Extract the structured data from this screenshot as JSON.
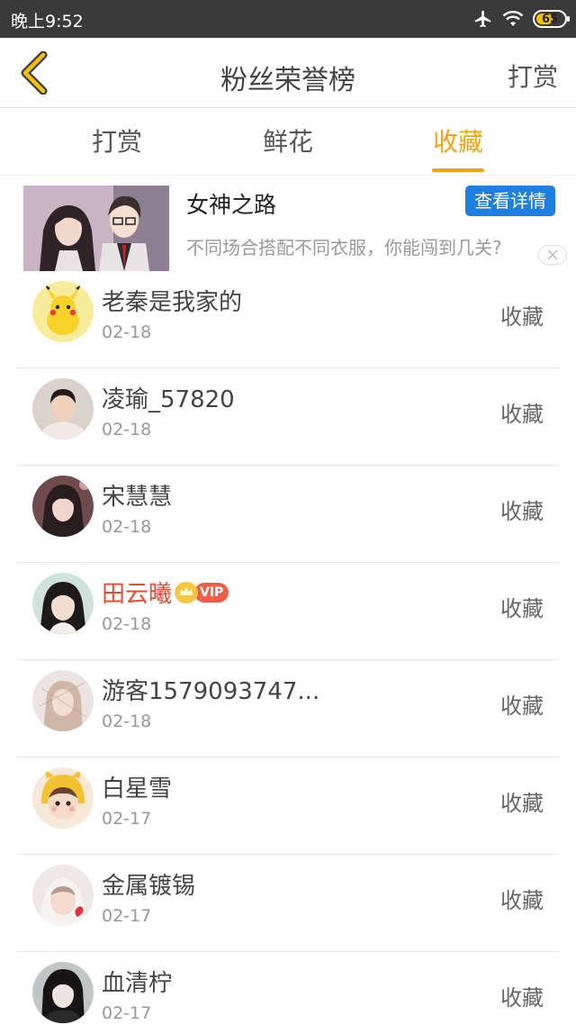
{
  "status_bar": {
    "time": "晚上9:52",
    "battery": "65",
    "battery_level": 0.65,
    "icons": [
      "airplane-icon",
      "wifi-icon",
      "battery-icon"
    ]
  },
  "header": {
    "back_icon": "chevron-left-icon",
    "title": "粉丝荣誉榜",
    "right_action": "打赏"
  },
  "tabs": [
    {
      "label": "打赏",
      "active": false
    },
    {
      "label": "鲜花",
      "active": false
    },
    {
      "label": "收藏",
      "active": true
    }
  ],
  "ad": {
    "title": "女神之路",
    "description": "不同场合搭配不同衣服，你能闯到几关?",
    "button": "查看详情",
    "close_icon": "close-icon"
  },
  "list": [
    {
      "name": "老秦是我家的",
      "date": "02-18",
      "action": "收藏",
      "vip": false
    },
    {
      "name": "凌瑜_57820",
      "date": "02-18",
      "action": "收藏",
      "vip": false
    },
    {
      "name": "宋慧慧",
      "date": "02-18",
      "action": "收藏",
      "vip": false
    },
    {
      "name": "田云曦",
      "date": "02-18",
      "action": "收藏",
      "vip": true,
      "vip_label": "VIP"
    },
    {
      "name": "游客1579093747...",
      "date": "02-18",
      "action": "收藏",
      "vip": false
    },
    {
      "name": "白星雪",
      "date": "02-17",
      "action": "收藏",
      "vip": false
    },
    {
      "name": "金属镀锡",
      "date": "02-17",
      "action": "收藏",
      "vip": false
    },
    {
      "name": "血清柠",
      "date": "02-17",
      "action": "收藏",
      "vip": false
    }
  ],
  "colors": {
    "accent": "#f3a319",
    "vip_name": "#e64b33",
    "ad_button": "#1f7fe0",
    "status_bar": "#3a3a3a"
  }
}
